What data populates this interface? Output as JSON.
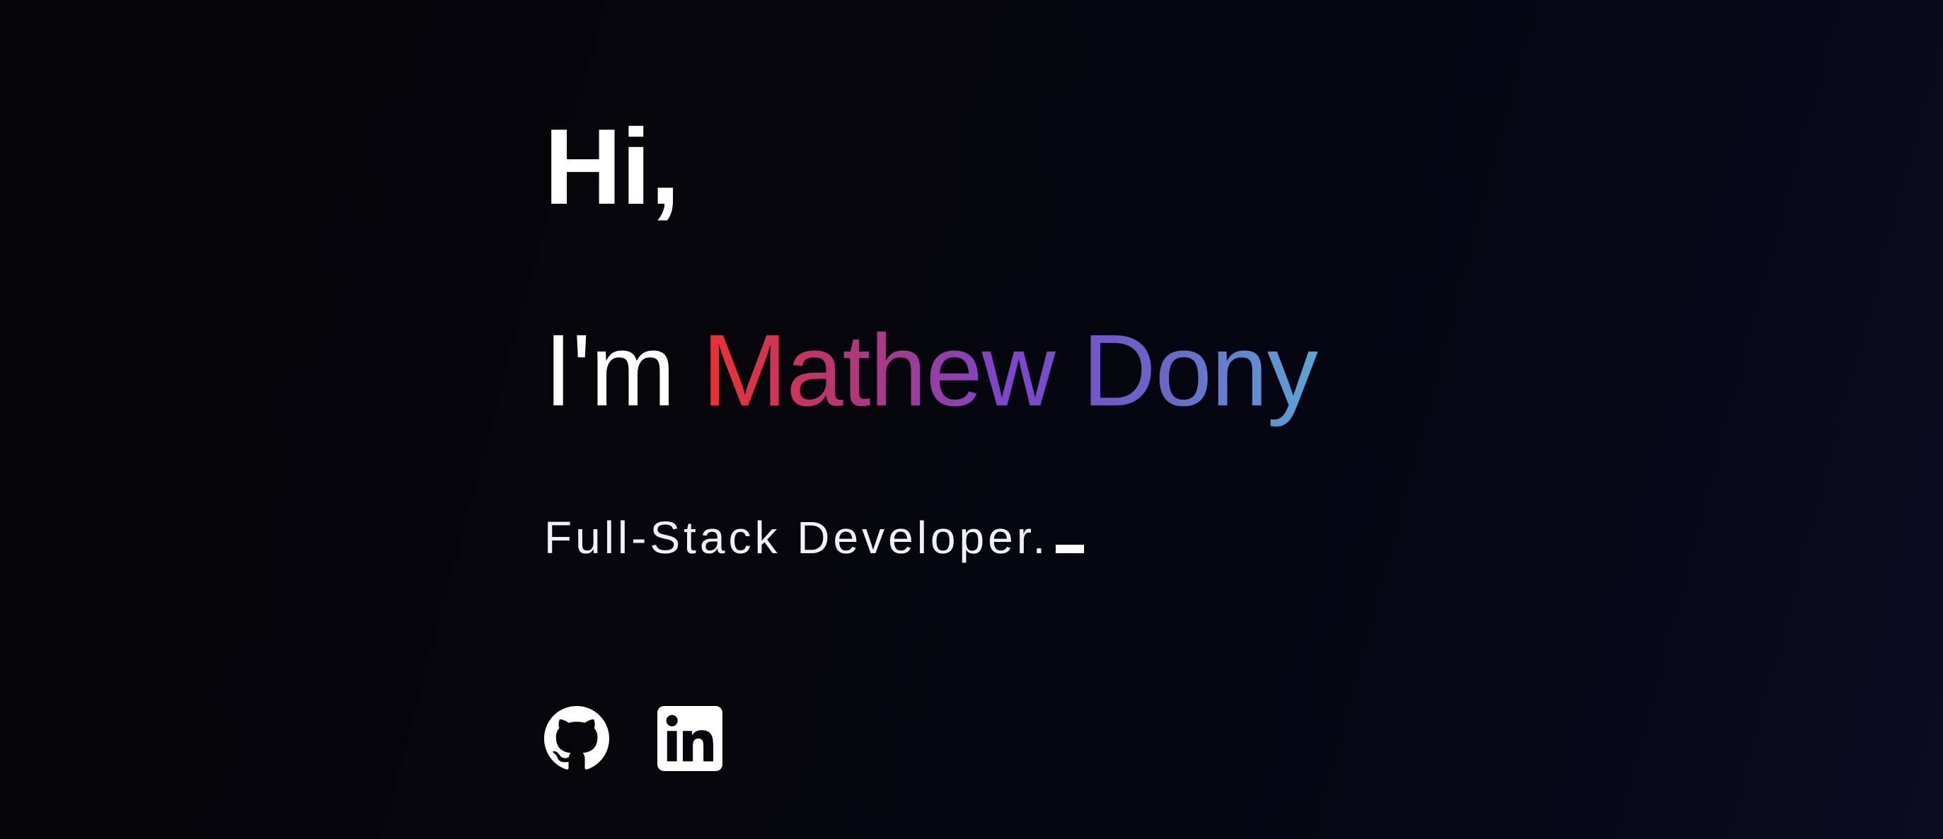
{
  "hero": {
    "greeting": "Hi,",
    "intro_prefix": "I'm ",
    "name": "Mathew Dony",
    "role": "Full-Stack Developer.",
    "name_gradient": [
      "#ef3030",
      "#b0387a",
      "#7c46cc",
      "#6a66c8",
      "#5aa6d6"
    ]
  },
  "socials": [
    {
      "icon": "github-icon"
    },
    {
      "icon": "linkedin-icon"
    }
  ],
  "colors": {
    "background": "#05050b",
    "text": "#ffffff"
  }
}
